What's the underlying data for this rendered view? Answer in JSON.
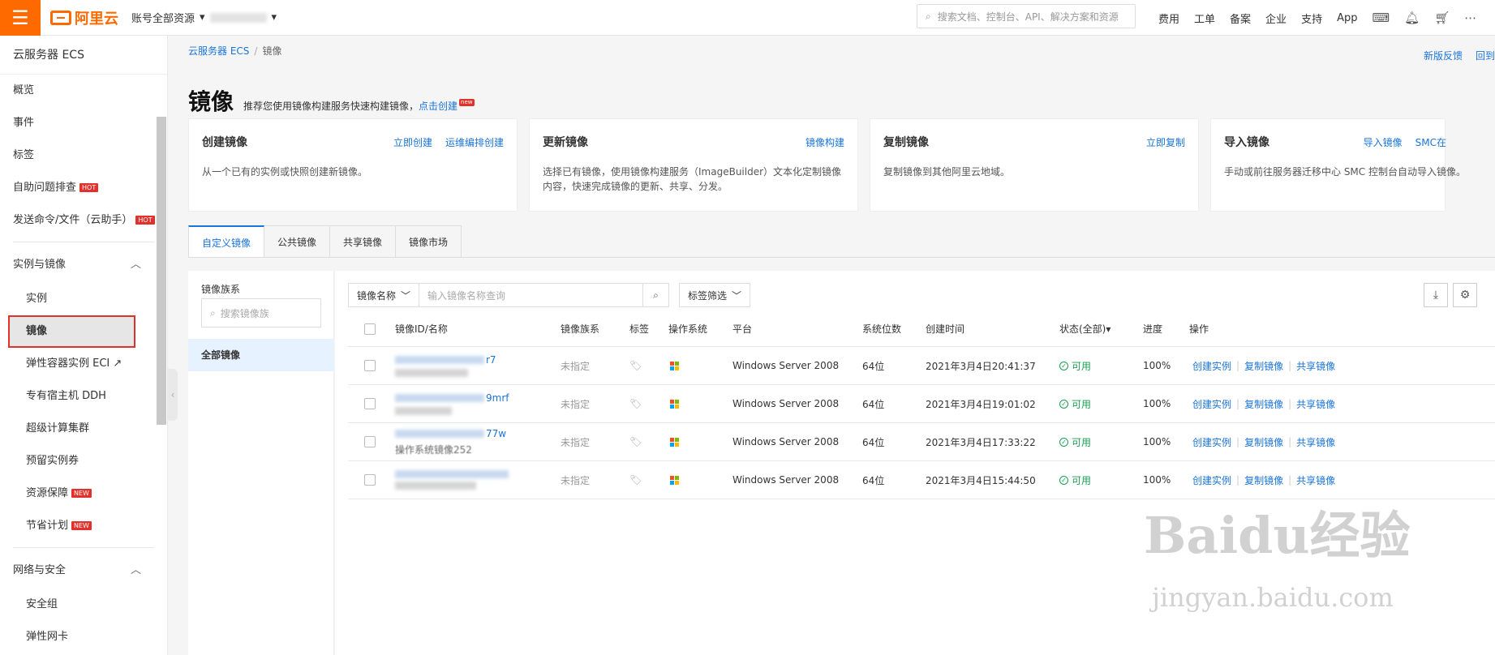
{
  "topbar": {
    "menu_icon": "hamburger-icon",
    "brand": "阿里云",
    "account_label": "账号全部资源",
    "search_placeholder": "搜索文档、控制台、API、解决方案和资源",
    "nav": [
      "费用",
      "工单",
      "备案",
      "企业",
      "支持",
      "App"
    ],
    "brand_color": "#ff6a00"
  },
  "sidebar": {
    "title": "云服务器 ECS",
    "top_items": [
      {
        "label": "概览"
      },
      {
        "label": "事件"
      },
      {
        "label": "标签"
      },
      {
        "label": "自助问题排查",
        "badge": "HOT"
      },
      {
        "label": "发送命令/文件（云助手）",
        "badge": "HOT"
      }
    ],
    "group1": {
      "label": "实例与镜像",
      "items": [
        {
          "label": "实例"
        },
        {
          "label": "镜像"
        },
        {
          "label": "弹性容器实例 ECI"
        },
        {
          "label": "专有宿主机 DDH"
        },
        {
          "label": "超级计算集群"
        },
        {
          "label": "预留实例券"
        },
        {
          "label": "资源保障",
          "badge": "NEW"
        },
        {
          "label": "节省计划",
          "badge": "NEW"
        }
      ]
    },
    "group2": {
      "label": "网络与安全",
      "items": [
        {
          "label": "安全组"
        },
        {
          "label": "弹性网卡"
        }
      ]
    }
  },
  "main": {
    "breadcrumb": [
      "云服务器 ECS",
      "镜像"
    ],
    "right_links": [
      "新版反馈",
      "回到"
    ],
    "title": "镜像",
    "tip_prefix": "推荐您使用镜像构建服务快速构建镜像，",
    "tip_link": "点击创建",
    "tip_badge": "new",
    "cards": [
      {
        "title": "创建镜像",
        "links": [
          "立即创建",
          "运维编排创建"
        ],
        "desc": "从一个已有的实例或快照创建新镜像。"
      },
      {
        "title": "更新镜像",
        "links": [
          "镜像构建"
        ],
        "desc": "选择已有镜像，使用镜像构建服务（ImageBuilder）文本化定制镜像内容，快速完成镜像的更新、共享、分发。"
      },
      {
        "title": "复制镜像",
        "links": [
          "立即复制"
        ],
        "desc": "复制镜像到其他阿里云地域。"
      },
      {
        "title": "导入镜像",
        "links": [
          "导入镜像",
          "SMC在"
        ],
        "desc": "手动或前往服务器迁移中心 SMC 控制台自动导入镜像。"
      }
    ],
    "tabs": [
      "自定义镜像",
      "公共镜像",
      "共享镜像",
      "镜像市场"
    ],
    "family": {
      "title": "镜像族系",
      "search_placeholder": "搜索镜像族",
      "all": "全部镜像"
    },
    "filter": {
      "select_label": "镜像名称",
      "search_placeholder": "输入镜像名称查询",
      "tag_filter": "标签筛选"
    },
    "table": {
      "headers": [
        "镜像ID/名称",
        "镜像族系",
        "标签",
        "操作系统",
        "平台",
        "系统位数",
        "创建时间",
        "状态(全部)",
        "进度",
        "操作"
      ],
      "rows": [
        {
          "id": "r7",
          "family": "未指定",
          "platform": "Windows Server 2008",
          "bits": "64位",
          "created": "2021年3月4日20:41:37",
          "status": "可用",
          "progress": "100%"
        },
        {
          "id": "9mrf",
          "family": "未指定",
          "platform": "Windows Server 2008",
          "bits": "64位",
          "created": "2021年3月4日19:01:02",
          "status": "可用",
          "progress": "100%"
        },
        {
          "id": "77w",
          "name": "操作系统镜像252",
          "family": "未指定",
          "platform": "Windows Server 2008",
          "bits": "64位",
          "created": "2021年3月4日17:33:22",
          "status": "可用",
          "progress": "100%"
        },
        {
          "id": "",
          "family": "未指定",
          "platform": "Windows Server 2008",
          "bits": "64位",
          "created": "2021年3月4日15:44:50",
          "status": "可用",
          "progress": "100%"
        }
      ],
      "ops": [
        "创建实例",
        "复制镜像",
        "共享镜像"
      ]
    }
  },
  "watermark": {
    "text": "Baidu经验",
    "sub": "jingyan.baidu.com"
  }
}
